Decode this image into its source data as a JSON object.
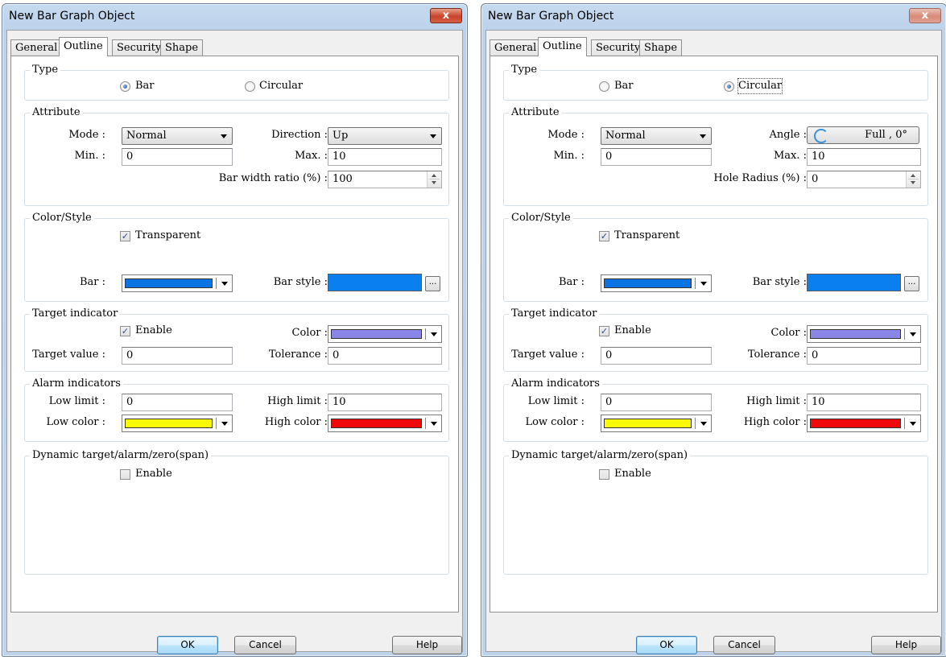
{
  "dialogs": [
    {
      "title": "New Bar Graph Object",
      "close_glyph": "x",
      "tabs": [
        "General",
        "Outline",
        "Security",
        "Shape"
      ],
      "active_tab": "Outline",
      "type": {
        "label": "Type",
        "option1": "Bar",
        "option2": "Circular",
        "selected": "Bar"
      },
      "attribute": {
        "label": "Attribute",
        "mode_label": "Mode :",
        "mode_value": "Normal",
        "direction_label": "Direction :",
        "direction_value": "Up",
        "min_label": "Min. :",
        "min_value": "0",
        "max_label": "Max. :",
        "max_value": "10",
        "ratio_label": "Bar width ratio (%) :",
        "ratio_value": "100"
      },
      "color_style": {
        "label": "Color/Style",
        "transparent_label": "Transparent",
        "transparent_checked": true,
        "bar_label": "Bar :",
        "bar_color": "#0a74e4",
        "bar_style_label": "Bar style :",
        "bar_style_color": "#0a80f0",
        "dots": "..."
      },
      "target": {
        "label": "Target indicator",
        "enable_label": "Enable",
        "enable_checked": true,
        "color_label": "Color :",
        "color": "#8a86e8",
        "target_value_label": "Target value :",
        "target_value": "0",
        "tolerance_label": "Tolerance :",
        "tolerance_value": "0"
      },
      "alarm": {
        "label": "Alarm indicators",
        "low_limit_label": "Low limit :",
        "low_limit": "0",
        "high_limit_label": "High limit :",
        "high_limit": "10",
        "low_color_label": "Low color :",
        "low_color": "#fafa00",
        "high_color_label": "High color :",
        "high_color": "#ee0a0a"
      },
      "dynamic": {
        "label": "Dynamic target/alarm/zero(span)",
        "enable_label": "Enable",
        "enable_checked": false
      },
      "buttons": {
        "ok": "OK",
        "cancel": "Cancel",
        "help": "Help"
      }
    },
    {
      "title": "New Bar Graph Object",
      "close_glyph": "x",
      "tabs": [
        "General",
        "Outline",
        "Security",
        "Shape"
      ],
      "active_tab": "Outline",
      "type": {
        "label": "Type",
        "option1": "Bar",
        "option2": "Circular",
        "selected": "Circular"
      },
      "attribute": {
        "label": "Attribute",
        "mode_label": "Mode :",
        "mode_value": "Normal",
        "angle_label": "Angle :",
        "angle_value": "Full , 0°",
        "min_label": "Min. :",
        "min_value": "0",
        "max_label": "Max. :",
        "max_value": "10",
        "hole_label": "Hole Radius (%) :",
        "hole_value": "0"
      },
      "color_style": {
        "label": "Color/Style",
        "transparent_label": "Transparent",
        "transparent_checked": true,
        "bar_label": "Bar :",
        "bar_color": "#0a74e4",
        "bar_style_label": "Bar style :",
        "bar_style_color": "#0a80f0",
        "dots": "..."
      },
      "target": {
        "label": "Target indicator",
        "enable_label": "Enable",
        "enable_checked": true,
        "color_label": "Color :",
        "color": "#8a86e8",
        "target_value_label": "Target value :",
        "target_value": "0",
        "tolerance_label": "Tolerance :",
        "tolerance_value": "0"
      },
      "alarm": {
        "label": "Alarm indicators",
        "low_limit_label": "Low limit :",
        "low_limit": "0",
        "high_limit_label": "High limit :",
        "high_limit": "10",
        "low_color_label": "Low color :",
        "low_color": "#fafa00",
        "high_color_label": "High color :",
        "high_color": "#ee0a0a"
      },
      "dynamic": {
        "label": "Dynamic target/alarm/zero(span)",
        "enable_label": "Enable",
        "enable_checked": false
      },
      "buttons": {
        "ok": "OK",
        "cancel": "Cancel",
        "help": "Help"
      }
    }
  ]
}
